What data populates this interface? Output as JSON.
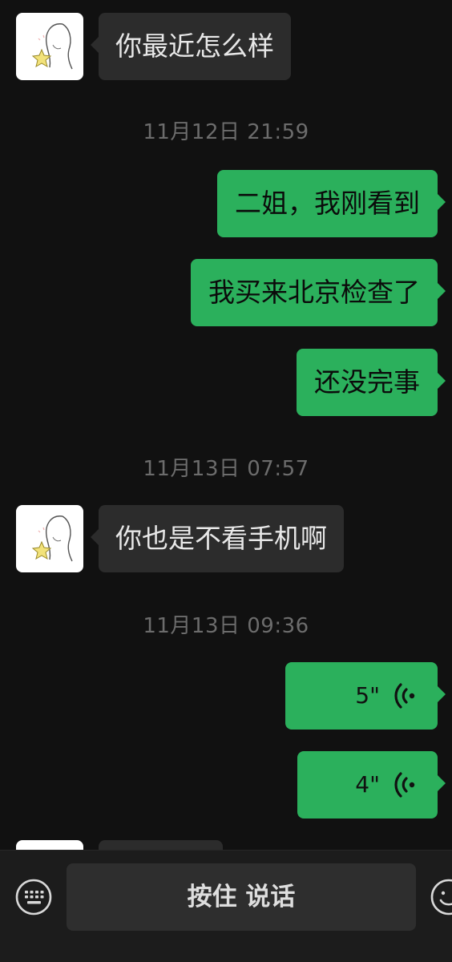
{
  "theme": {
    "background": "#111111",
    "incoming_bubble": "#2c2c2c",
    "outgoing_bubble": "#2bb05c",
    "timestamp_color": "#6c6c6c"
  },
  "messages": [
    {
      "type": "incoming_text",
      "text": "你最近怎么样",
      "avatar_icon": "girl-sketch-avatar-icon"
    },
    {
      "type": "timestamp",
      "text": "11月12日 21:59"
    },
    {
      "type": "outgoing_text",
      "text": "二姐，我刚看到"
    },
    {
      "type": "outgoing_text",
      "text": "我买来北京检查了"
    },
    {
      "type": "outgoing_text",
      "text": "还没完事"
    },
    {
      "type": "timestamp",
      "text": "11月13日 07:57"
    },
    {
      "type": "incoming_text",
      "text": "你也是不看手机啊",
      "avatar_icon": "girl-sketch-avatar-icon"
    },
    {
      "type": "timestamp",
      "text": "11月13日 09:36"
    },
    {
      "type": "outgoing_voice",
      "duration": "5\"",
      "icon": "voice-wave-icon"
    },
    {
      "type": "outgoing_voice",
      "duration": "4\"",
      "icon": "voice-wave-icon"
    }
  ],
  "input_bar": {
    "left_icon": "keyboard-icon",
    "hold_to_talk_label": "按住 说话",
    "right_icon": "emoji-icon"
  }
}
